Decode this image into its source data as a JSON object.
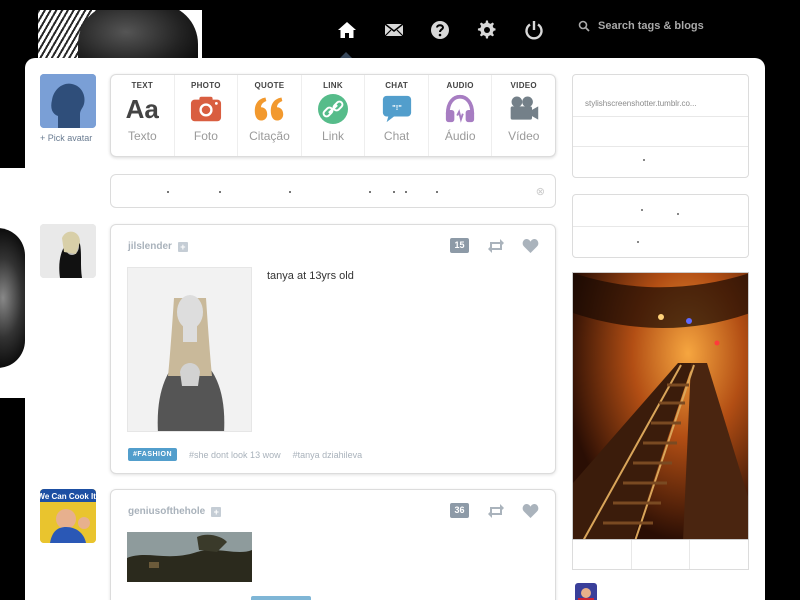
{
  "nav": {
    "items": [
      "home-icon",
      "mail-icon",
      "help-icon",
      "gear-icon",
      "power-icon"
    ],
    "search_placeholder": "Search tags & blogs"
  },
  "dashboard": {
    "pick_avatar": "+ Pick avatar",
    "post_types": [
      {
        "caption": "TEXT",
        "label": "Texto",
        "icon": "text-icon",
        "color": "#444444"
      },
      {
        "caption": "PHOTO",
        "label": "Foto",
        "icon": "camera-icon",
        "color": "#d95e40"
      },
      {
        "caption": "QUOTE",
        "label": "Citação",
        "icon": "quote-icon",
        "color": "#f2992e"
      },
      {
        "caption": "LINK",
        "label": "Link",
        "icon": "link-icon",
        "color": "#56bc8a"
      },
      {
        "caption": "CHAT",
        "label": "Chat",
        "icon": "chat-icon",
        "color": "#529ecc"
      },
      {
        "caption": "AUDIO",
        "label": "Áudio",
        "icon": "headphones-icon",
        "color": "#a77dc2"
      },
      {
        "caption": "VIDEO",
        "label": "Vídeo",
        "icon": "video-camera-icon",
        "color": "#748089"
      }
    ]
  },
  "posts": [
    {
      "author": "jilslender",
      "notes": "15",
      "caption": "tanya at 13yrs old",
      "tags": [
        "#FASHION",
        "#she dont look 13 wow",
        "#tanya dziahileva"
      ]
    },
    {
      "author": "geniusofthehole",
      "notes": "36"
    }
  ],
  "sidebar": {
    "blog_url": "stylishscreenshotter.tumblr.co..."
  },
  "avatars": {
    "second": "We Can Cook It!"
  }
}
